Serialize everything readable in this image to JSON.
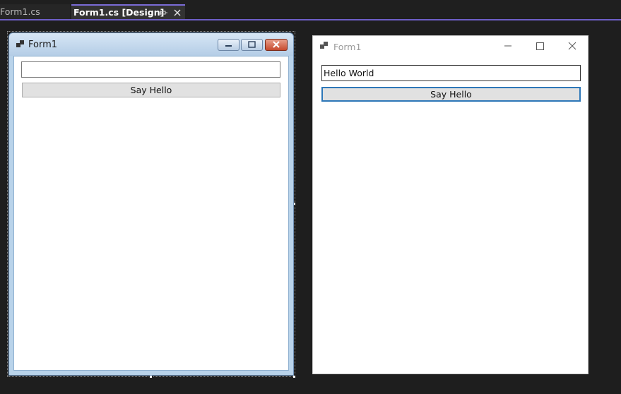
{
  "tabs": [
    {
      "label": "Form1.cs",
      "active": false
    },
    {
      "label": "Form1.cs [Design]",
      "active": true
    }
  ],
  "tab_icons": {
    "pin": "pin-icon",
    "close": "close-icon"
  },
  "designer_form": {
    "caption": "Form1",
    "textbox_value": "",
    "button_label": "Say Hello",
    "window_buttons": [
      "minimize",
      "maximize",
      "close"
    ]
  },
  "running_form": {
    "caption": "Form1",
    "textbox_value": "Hello World",
    "button_label": "Say Hello",
    "window_buttons": [
      "minimize",
      "maximize",
      "close"
    ]
  },
  "colors": {
    "accent": "#6e5fc8",
    "background": "#1e1e1e",
    "focus_border": "#2d77b8"
  }
}
